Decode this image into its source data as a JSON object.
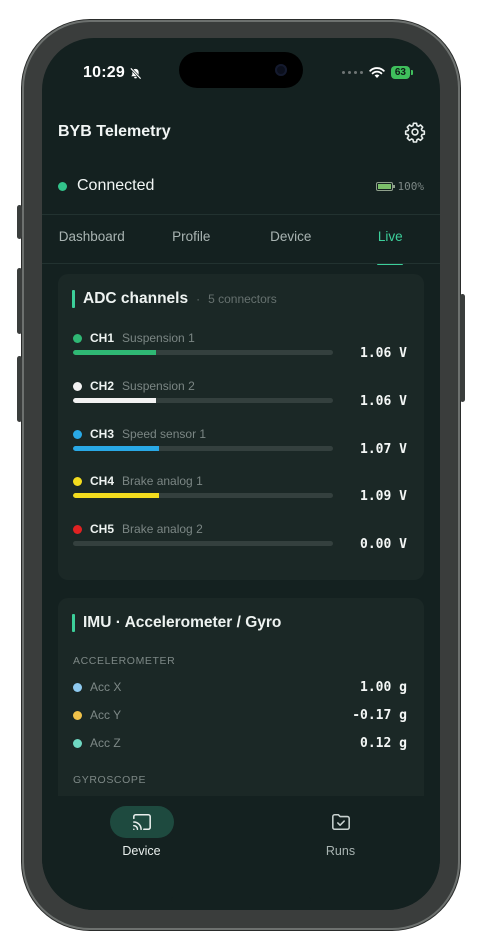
{
  "status_bar": {
    "time": "10:29",
    "battery": "63"
  },
  "header": {
    "title": "BYB Telemetry"
  },
  "connection": {
    "status": "Connected",
    "battery_pct": "100%",
    "status_color": "#32c28a"
  },
  "tabs": [
    {
      "label": "Dashboard",
      "active": false
    },
    {
      "label": "Profile",
      "active": false
    },
    {
      "label": "Device",
      "active": false
    },
    {
      "label": "Live",
      "active": true
    }
  ],
  "adc": {
    "title": "ADC channels",
    "separator": "·",
    "subtitle": "5 connectors",
    "channels": [
      {
        "id": "CH1",
        "name": "Suspension 1",
        "value": "1.06 V",
        "level": 0.32,
        "color": "#2fb874"
      },
      {
        "id": "CH2",
        "name": "Suspension 2",
        "value": "1.06 V",
        "level": 0.32,
        "color": "#f2f2f2"
      },
      {
        "id": "CH3",
        "name": "Speed sensor 1",
        "value": "1.07 V",
        "level": 0.33,
        "color": "#29a9e6"
      },
      {
        "id": "CH4",
        "name": "Brake analog 1",
        "value": "1.09 V",
        "level": 0.33,
        "color": "#f3dc1e"
      },
      {
        "id": "CH5",
        "name": "Brake analog 2",
        "value": "0.00 V",
        "level": 0.0,
        "color": "#e02222"
      }
    ]
  },
  "imu": {
    "title": "IMU · Accelerometer / Gyro",
    "accel_label": "ACCELEROMETER",
    "gyro_label": "GYROSCOPE",
    "accel": [
      {
        "label": "Acc X",
        "value": "1.00 g",
        "color": "#8ec9ef"
      },
      {
        "label": "Acc Y",
        "value": "-0.17 g",
        "color": "#f0c24a"
      },
      {
        "label": "Acc Z",
        "value": "0.12 g",
        "color": "#6fd8c2"
      }
    ]
  },
  "bottom_nav": [
    {
      "label": "Device",
      "icon": "cast-icon",
      "active": true
    },
    {
      "label": "Runs",
      "icon": "folder-check-icon",
      "active": false
    }
  ]
}
